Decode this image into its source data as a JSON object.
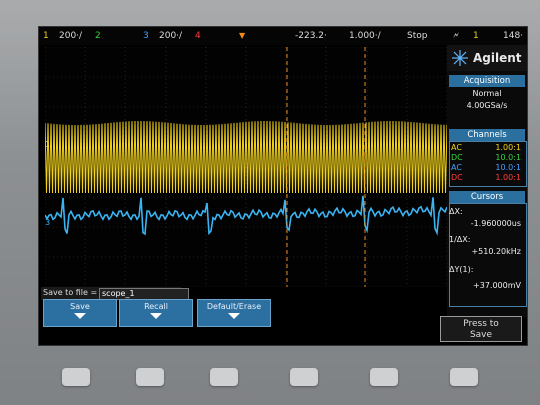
{
  "topbar": {
    "ch1_num": "1",
    "ch1_scale": "200‧/",
    "ch2_num": "2",
    "ch3_num": "3",
    "ch3_scale": "200‧/",
    "ch4_num": "4",
    "delay": "-223.2‧",
    "timebase": "1.000‧/",
    "run_state": "Stop",
    "trigger_source": "1",
    "trigger_level": "148‧"
  },
  "brand": "Agilent",
  "acquisition": {
    "title": "Acquisition",
    "mode": "Normal",
    "rate": "4.00GSa/s"
  },
  "channels": {
    "title": "Channels",
    "rows": [
      {
        "coupling": "AC",
        "probe": "1.00:1",
        "color": "#f2d21b"
      },
      {
        "coupling": "DC",
        "probe": "10.0:1",
        "color": "#38d23a"
      },
      {
        "coupling": "AC",
        "probe": "10.0:1",
        "color": "#4aa0ff"
      },
      {
        "coupling": "DC",
        "probe": "1.00:1",
        "color": "#ff3c3c"
      }
    ]
  },
  "cursors": {
    "title": "Cursors",
    "dx_label": "ΔX:",
    "dx_value": "-1.960000us",
    "inv_dx_label": "1/ΔX:",
    "inv_dx_value": "+510.20kHz",
    "dy_label": "ΔY(1):",
    "dy_value": "+37.000mV"
  },
  "save": {
    "label": "Save to file =",
    "filename": "scope_1"
  },
  "softkeys": {
    "save": "Save",
    "recall": "Recall",
    "default_erase": "Default/Erase"
  },
  "press_to_save": {
    "line1": "Press to",
    "line2": "Save"
  },
  "colors": {
    "ch1": "#f2d21b",
    "ch3": "#3ab4f2",
    "cursor": "#f08a1c",
    "accent": "#2c6fa1"
  }
}
